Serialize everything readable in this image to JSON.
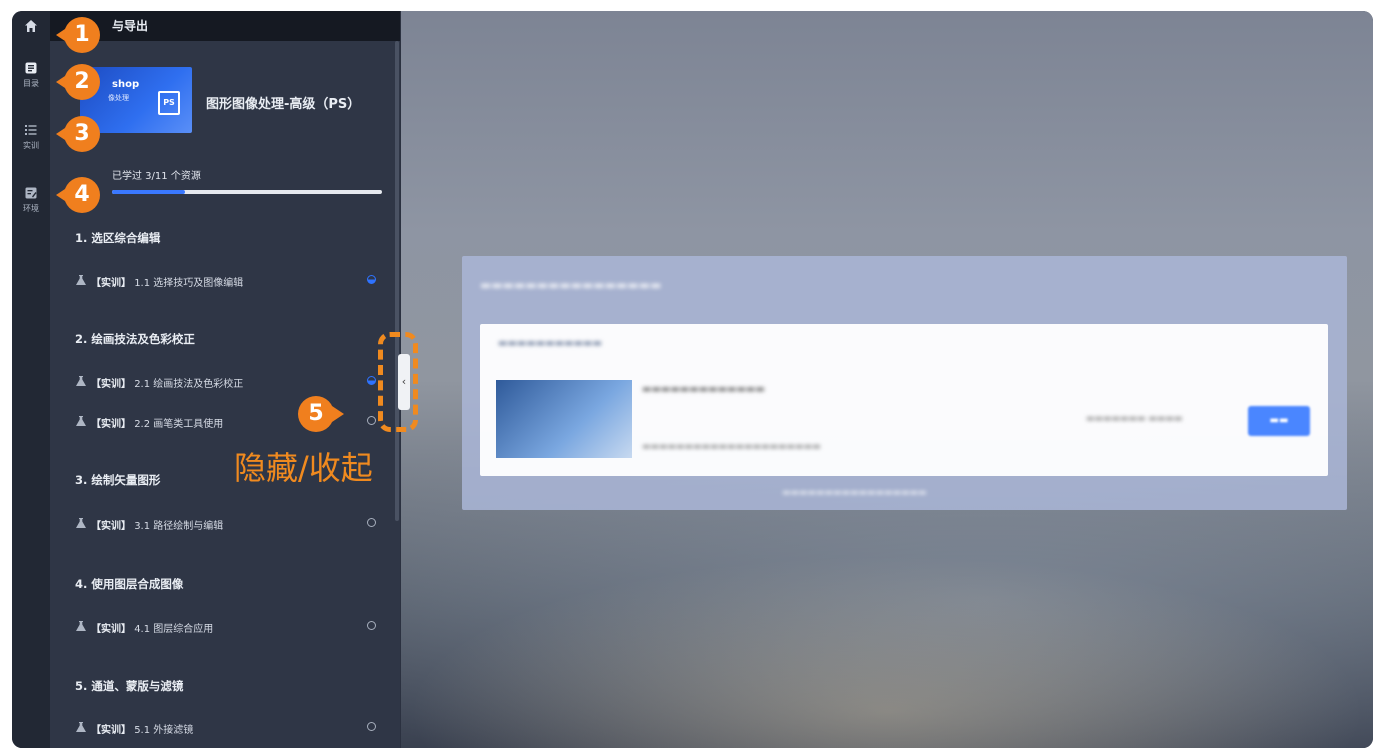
{
  "sidebar": {
    "home_icon": "home-icon",
    "items": [
      {
        "label": "目录",
        "icon": "document-icon"
      },
      {
        "label": "实训",
        "icon": "list-icon"
      },
      {
        "label": "环境",
        "icon": "edit-icon"
      }
    ]
  },
  "panel": {
    "header_title": "与导出",
    "course": {
      "card_word": "shop",
      "card_sub": "像处理",
      "card_badge": "PS",
      "title": "图形图像处理-高级（PS）"
    },
    "progress": {
      "label": "已学过 3/11 个资源",
      "fraction": 0.27
    },
    "sections": [
      {
        "title": "1. 选区综合编辑",
        "lessons": [
          {
            "tag": "【实训】",
            "name": "1.1 选择技巧及图像编辑",
            "status": "half"
          }
        ]
      },
      {
        "title": "2. 绘画技法及色彩校正",
        "lessons": [
          {
            "tag": "【实训】",
            "name": "2.1 绘画技法及色彩校正",
            "status": "half"
          },
          {
            "tag": "【实训】",
            "name": "2.2 画笔类工具使用",
            "status": "empty"
          }
        ]
      },
      {
        "title": "3. 绘制矢量图形",
        "lessons": [
          {
            "tag": "【实训】",
            "name": "3.1 路径绘制与编辑",
            "status": "empty"
          }
        ]
      },
      {
        "title": "4. 使用图层合成图像",
        "lessons": [
          {
            "tag": "【实训】",
            "name": "4.1 图层综合应用",
            "status": "empty"
          }
        ]
      },
      {
        "title": "5. 通道、蒙版与滤镜",
        "lessons": [
          {
            "tag": "【实训】",
            "name": "5.1 外接滤镜",
            "status": "empty"
          }
        ]
      }
    ]
  },
  "collapse_handle": {
    "glyph": "‹"
  },
  "annotations": {
    "callouts": [
      "1",
      "2",
      "3",
      "4",
      "5"
    ],
    "collapse_label": "隐藏/收起"
  },
  "colors": {
    "accent": "#f07f1e",
    "progress": "#3a78ff",
    "panel": "#2f3646"
  }
}
